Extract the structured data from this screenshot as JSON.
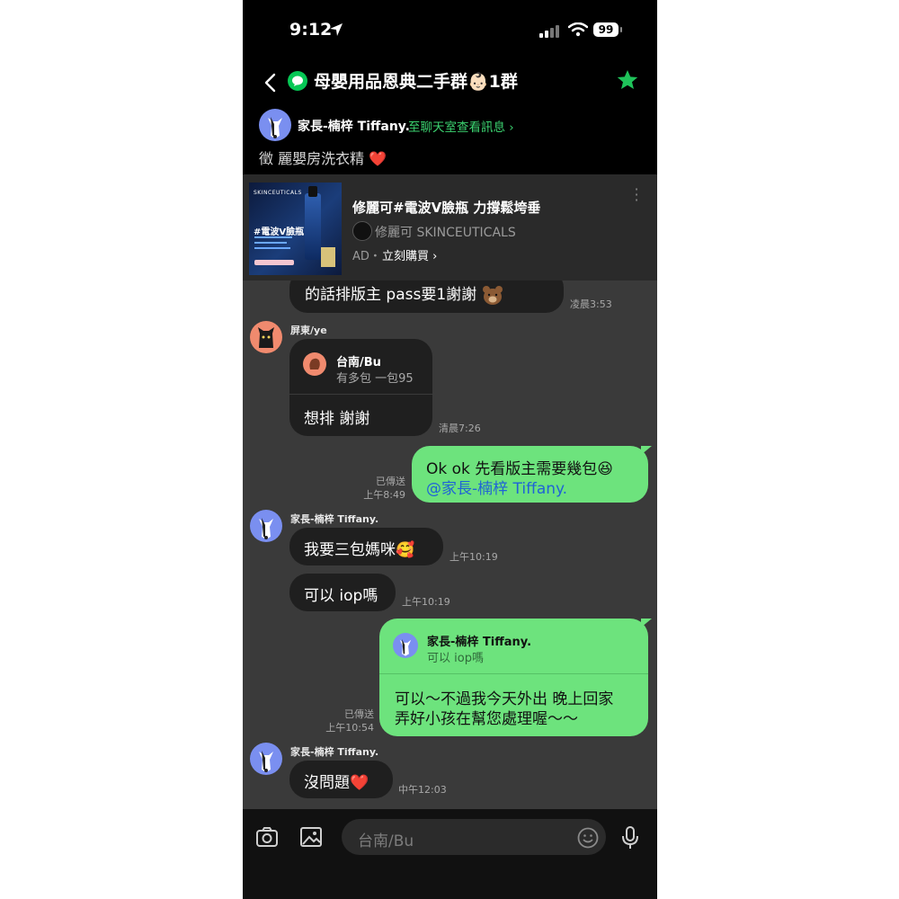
{
  "status": {
    "time": "9:12",
    "battery": "99"
  },
  "header": {
    "title": "母嬰用品恩典二手群👶🏻1群",
    "announcement": {
      "name": "家長-楠梓 Tiffany.",
      "link": "至聊天室查看訊息 ›",
      "text": "徵 麗嬰房洗衣精 ❤️"
    }
  },
  "ad": {
    "title": "修麗可#電波V臉瓶 力撐鬆垮垂",
    "brand": "修麗可 SKINCEUTICALS",
    "label": "AD・",
    "cta": "立刻購買 ›",
    "image_text": [
      "SKINCEUTICALS",
      "#電波V臉瓶"
    ]
  },
  "messages": {
    "m1": {
      "text": "的話排版主 pass要1謝謝",
      "time": "凌晨3:53"
    },
    "m2": {
      "sender": "屏東/ye",
      "reply_name": "台南/Bu",
      "reply_text": "有多包 一包95",
      "text": "想排 謝謝",
      "time": "清晨7:26"
    },
    "m3": {
      "text": "Ok ok 先看版主需要幾包😆",
      "mention": "@家長-楠梓 Tiffany.",
      "read": "已傳送",
      "time": "上午8:49"
    },
    "m4": {
      "sender": "家長-楠梓 Tiffany.",
      "text": "我要三包媽咪🥰",
      "time": "上午10:19"
    },
    "m5": {
      "text": "可以 iop嗎",
      "time": "上午10:19"
    },
    "m6": {
      "reply_name": "家長-楠梓 Tiffany.",
      "reply_text": "可以 iop嗎",
      "line1": "可以～不過我今天外出 晚上回家",
      "line2": "弄好小孩在幫您處理喔～～",
      "read": "已傳送",
      "time": "上午10:54"
    },
    "m7": {
      "sender": "家長-楠梓 Tiffany.",
      "text": "沒問題❤️",
      "time": "中午12:03"
    }
  },
  "input": {
    "placeholder": "台南/Bu"
  },
  "colors": {
    "line_green": "#06c755",
    "bubble_green": "#6de37d",
    "background": "#3a3a3a"
  },
  "icons": [
    "back-icon",
    "star-icon",
    "camera-icon",
    "image-icon",
    "emoji-icon",
    "mic-icon"
  ]
}
